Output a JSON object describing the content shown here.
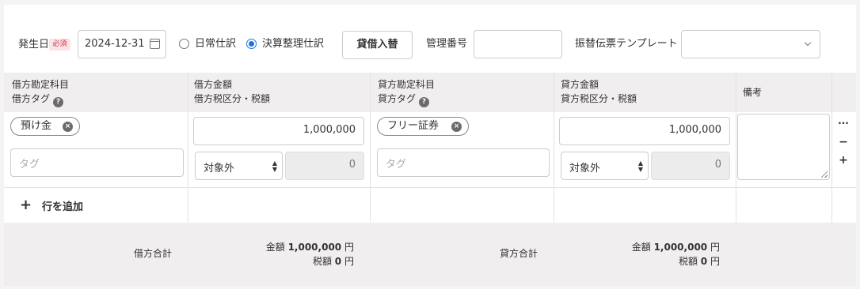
{
  "filters": {
    "date_label": "発生日",
    "required_badge": "必須",
    "date_value": "2024-12-31",
    "radio_normal": "日常仕訳",
    "radio_closing": "決算整理仕訳",
    "swap_button": "貸借入替",
    "mgmt_label": "管理番号",
    "mgmt_value": "",
    "template_label": "振替伝票テンプレート",
    "template_value": ""
  },
  "columns": {
    "debit_account": "借方勘定科目",
    "debit_tag": "借方タグ",
    "debit_amount": "借方金額",
    "debit_tax": "借方税区分・税額",
    "credit_account": "貸方勘定科目",
    "credit_tag": "貸方タグ",
    "credit_amount": "貸方金額",
    "credit_tax": "貸方税区分・税額",
    "memo": "備考",
    "help_icon": "?"
  },
  "row": {
    "debit_account": "預け金",
    "debit_tag_placeholder": "タグ",
    "debit_amount": "1,000,000",
    "debit_tax_category": "対象外",
    "debit_tax_amount": "0",
    "credit_account": "フリー証券",
    "credit_tag_placeholder": "タグ",
    "credit_amount": "1,000,000",
    "credit_tax_category": "対象外",
    "credit_tax_amount": "0",
    "memo": "",
    "more_icon": "···",
    "remove_icon": "−",
    "add_icon": "+",
    "clear_icon": "×"
  },
  "add_row": {
    "plus": "+",
    "label": "行を追加"
  },
  "totals": {
    "debit_label": "借方合計",
    "credit_label": "貸方合計",
    "amount_prefix": "金額",
    "tax_prefix": "税額",
    "debit_amount": "1,000,000",
    "debit_tax": "0",
    "credit_amount": "1,000,000",
    "credit_tax": "0",
    "unit": "円"
  },
  "colors": {
    "accent": "#1a73e8",
    "required_bg": "#fbe3e6",
    "required_fg": "#c8354e",
    "header_bg": "#f0eeee"
  }
}
